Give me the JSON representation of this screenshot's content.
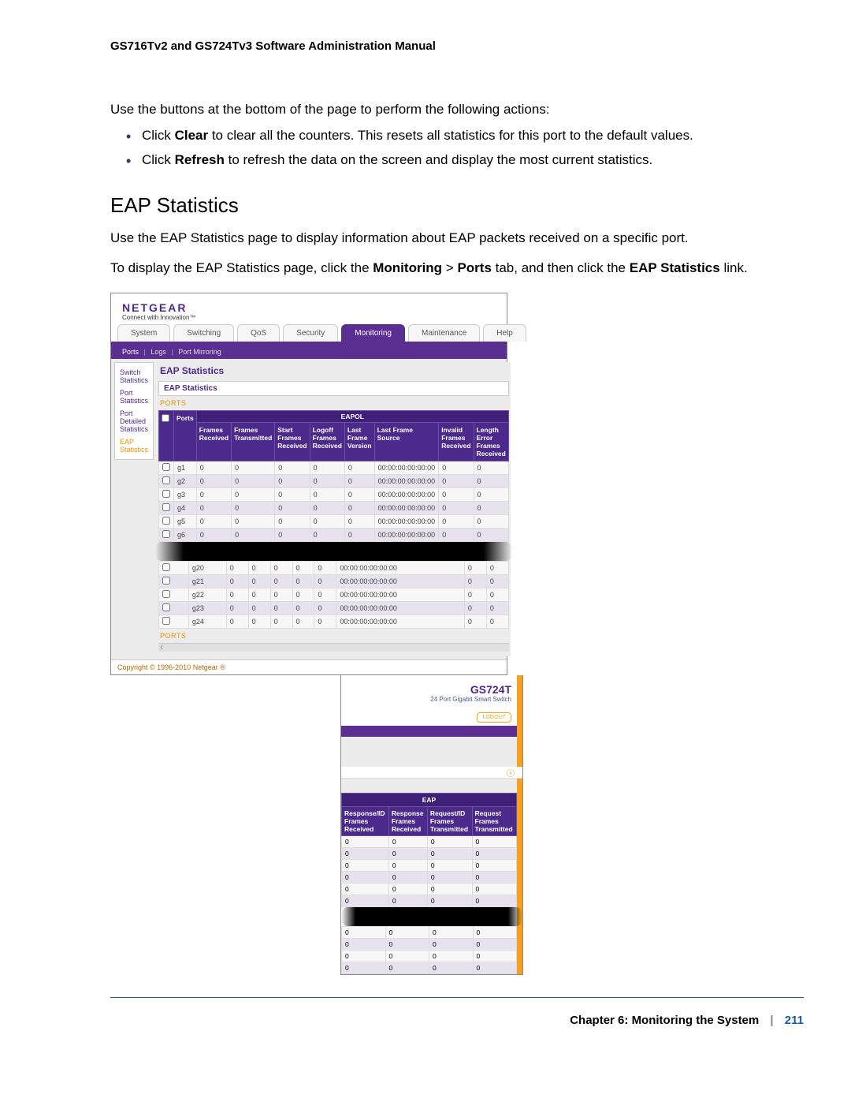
{
  "doc": {
    "header": "GS716Tv2 and GS724Tv3 Software Administration Manual",
    "intro": "Use the buttons at the bottom of the page to perform the following actions:",
    "bullet1_pre": "Click ",
    "bullet1_bold": "Clear",
    "bullet1_post": " to clear all the counters. This resets all statistics for this port to the default values.",
    "bullet2_pre": "Click ",
    "bullet2_bold": "Refresh",
    "bullet2_post": " to refresh the data on the screen and display the most current statistics.",
    "h2": "EAP Statistics",
    "p1": "Use the EAP Statistics page to display information about EAP packets received on a specific port.",
    "p2_a": "To display the EAP Statistics page, click the ",
    "p2_b": "Monitoring",
    "p2_c": " > ",
    "p2_d": "Ports",
    "p2_e": " tab, and then click the ",
    "p2_f": "EAP Statistics",
    "p2_g": " link.",
    "footer_chapter": "Chapter 6:  Monitoring the System",
    "footer_page": "211"
  },
  "ui": {
    "brand": "NETGEAR",
    "brand_tag": "Connect with Innovation™",
    "tabs": [
      "System",
      "Switching",
      "QoS",
      "Security",
      "Monitoring",
      "Maintenance",
      "Help"
    ],
    "subnav": [
      "Ports",
      "Logs",
      "Port Mirroring"
    ],
    "side": {
      "items": [
        "Switch Statistics",
        "Port Statistics",
        "Port Detailed Statistics",
        "EAP Statistics"
      ]
    },
    "panel_title": "EAP Statistics",
    "sub_title": "EAP Statistics",
    "ports_label": "PORTS",
    "group_eapol": "EAPOL",
    "cols": {
      "ports": "Ports",
      "fr": "Frames Received",
      "ft": "Frames Transmitted",
      "sfr": "Start Frames Received",
      "lfr": "Logoff Frames Received",
      "lfv": "Last Frame Version",
      "lfs": "Last Frame Source",
      "ifr": "Invalid Frames Received",
      "ler": "Length Error Frames Received"
    },
    "rows_top": [
      {
        "p": "g1",
        "v": "0",
        "mac": "00:00:00:00:00:00"
      },
      {
        "p": "g2",
        "v": "0",
        "mac": "00:00:00:00:00:00"
      },
      {
        "p": "g3",
        "v": "0",
        "mac": "00:00:00:00:00:00"
      },
      {
        "p": "g4",
        "v": "0",
        "mac": "00:00:00:00:00:00"
      },
      {
        "p": "g5",
        "v": "0",
        "mac": "00:00:00:00:00:00"
      },
      {
        "p": "g6",
        "v": "0",
        "mac": "00:00:00:00:00:00"
      }
    ],
    "rows_bot": [
      {
        "p": "g20",
        "v": "0",
        "mac": "00:00:00:00:00:00"
      },
      {
        "p": "g21",
        "v": "0",
        "mac": "00:00:00:00:00:00"
      },
      {
        "p": "g22",
        "v": "0",
        "mac": "00:00:00:00:00:00"
      },
      {
        "p": "g23",
        "v": "0",
        "mac": "00:00:00:00:00:00"
      },
      {
        "p": "g24",
        "v": "0",
        "mac": "00:00:00:00:00:00"
      }
    ],
    "copyright": "Copyright © 1996-2010 Netgear ®"
  },
  "ui2": {
    "model": "GS724T",
    "desc": "24 Port Gigabit Smart Switch",
    "logout": "LOGOUT",
    "group_eap": "EAP",
    "cols": {
      "a": "Response/ID Frames Received",
      "b": "Response Frames Received",
      "c": "Request/ID Frames Transmitted",
      "d": "Request Frames Transmitted"
    },
    "rows_top": [
      {
        "v": "0"
      },
      {
        "v": "0"
      },
      {
        "v": "0"
      },
      {
        "v": "0"
      },
      {
        "v": "0"
      },
      {
        "v": "0"
      }
    ],
    "rows_bot": [
      {
        "v": "0"
      },
      {
        "v": "0"
      },
      {
        "v": "0"
      },
      {
        "v": "0"
      }
    ]
  }
}
